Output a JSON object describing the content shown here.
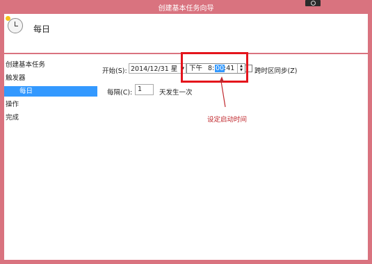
{
  "window": {
    "title": "创建基本任务向导"
  },
  "header": {
    "title": "每日",
    "icon": "calendar-clock-icon"
  },
  "nav": {
    "items": [
      {
        "label": "创建基本任务"
      },
      {
        "label": "触发器"
      },
      {
        "label": "每日",
        "selected": true
      },
      {
        "label": "操作"
      },
      {
        "label": "完成"
      }
    ]
  },
  "form": {
    "start_label": "开始(S):",
    "date_value": "2014/12/31 星",
    "time_ampm": "下午",
    "time_hour": "8:",
    "time_minute": "00",
    "time_second": ":41",
    "sync_label": "跨时区同步(Z)",
    "every_label": "每隔(C):",
    "every_value": "1",
    "every_suffix": "天发生一次"
  },
  "annotation": {
    "text": "设定启动时间",
    "color": "#c0282d"
  },
  "colors": {
    "titlebar": "#d9737f",
    "selection": "#3399ff",
    "highlight": "#e4141c"
  }
}
